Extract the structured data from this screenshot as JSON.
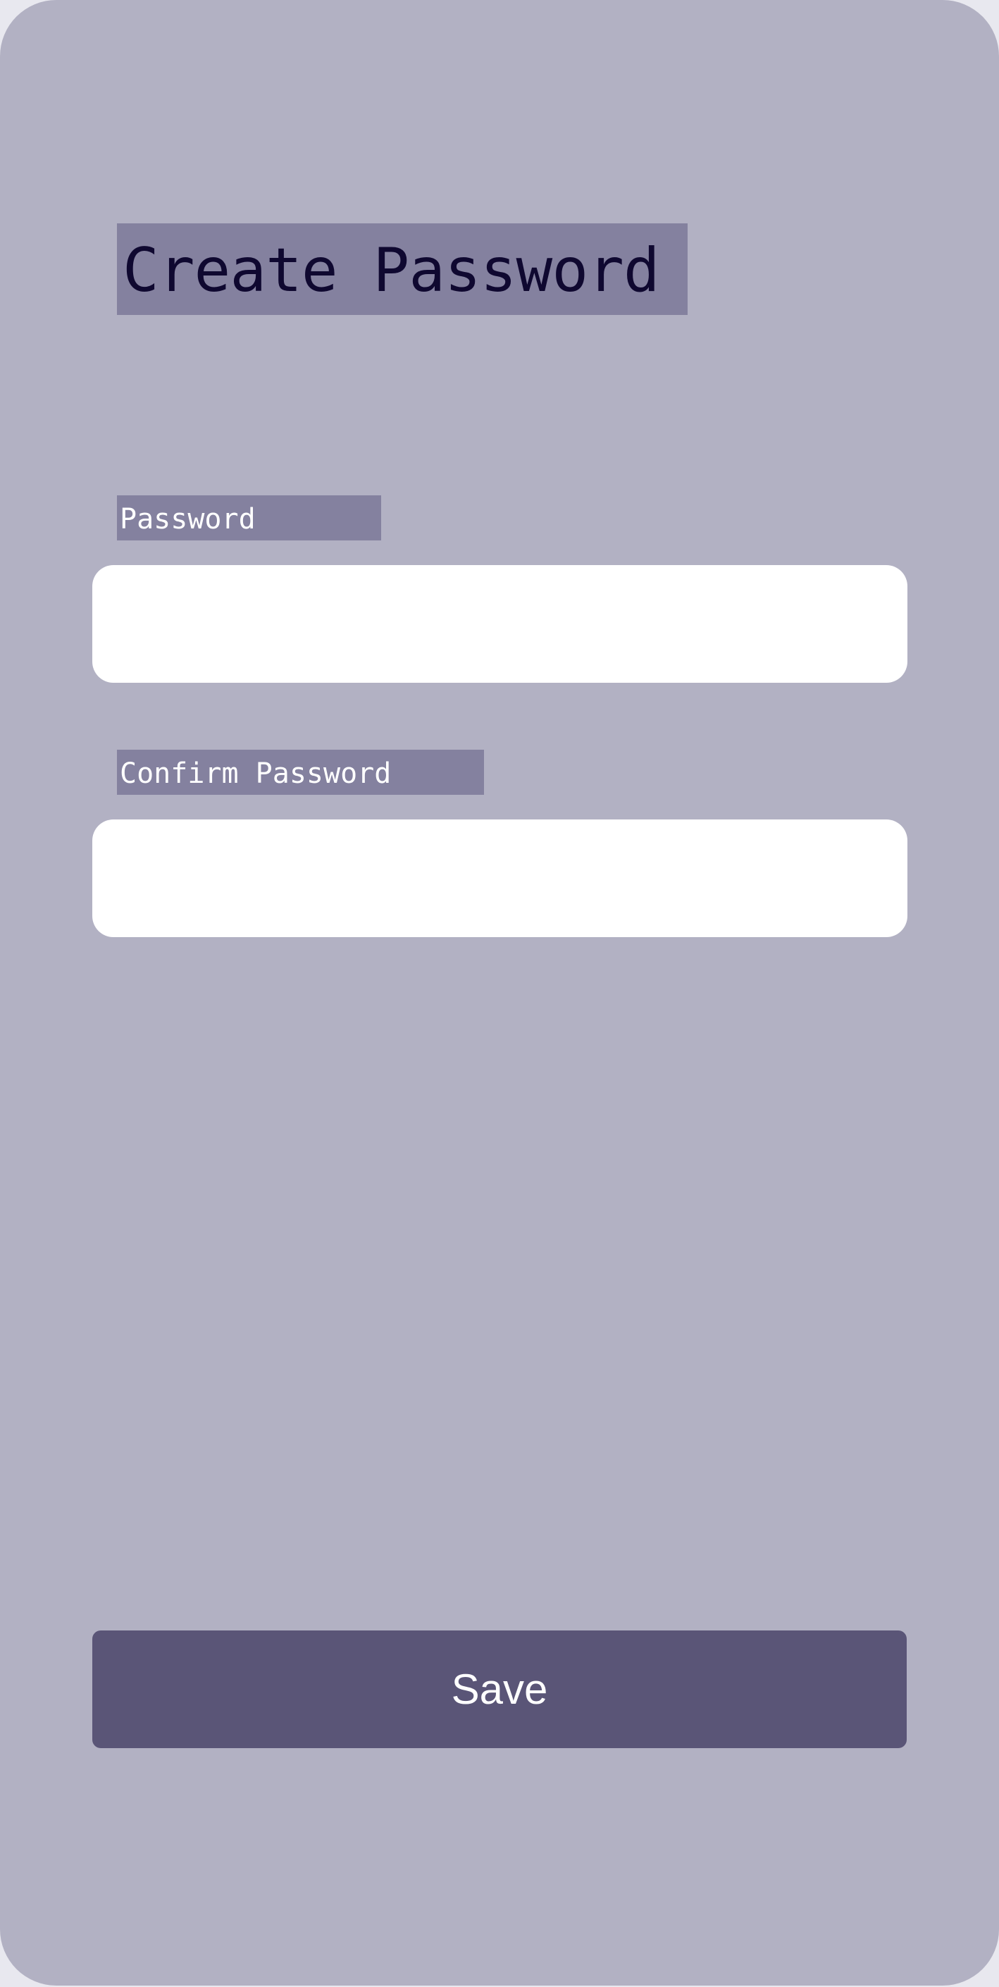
{
  "screen": {
    "title": "Create Password"
  },
  "form": {
    "password_label": "Password",
    "password_value": "",
    "confirm_label": "Confirm Password",
    "confirm_value": ""
  },
  "actions": {
    "save_label": "Save"
  },
  "colors": {
    "background": "#b2b1c3",
    "label_bg": "#84819f",
    "title_text": "#0f0830",
    "button_bg": "#5a5577",
    "input_bg": "#ffffff"
  }
}
